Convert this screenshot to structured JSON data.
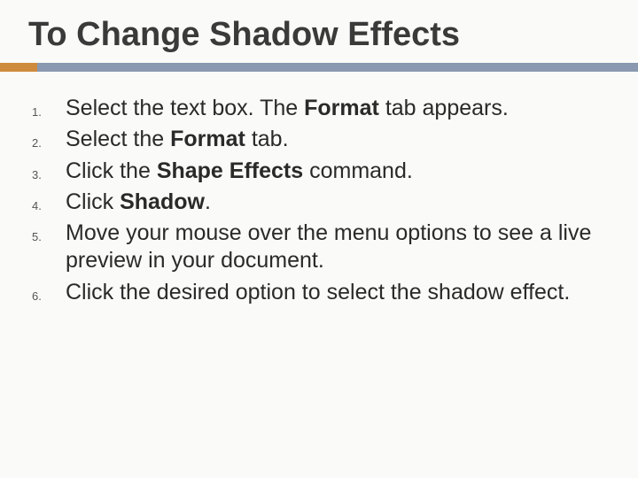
{
  "title": "To Change Shadow Effects",
  "steps": [
    {
      "pre": "Select the text box. The ",
      "bold": "Format",
      "post": " tab appears."
    },
    {
      "pre": "Select the ",
      "bold": "Format",
      "post": " tab."
    },
    {
      "pre": "Click the ",
      "bold": "Shape Effects",
      "post": " command."
    },
    {
      "pre": "Click ",
      "bold": "Shadow",
      "post": "."
    },
    {
      "pre": "Move your mouse over the menu options to see a live preview in your document.",
      "bold": "",
      "post": ""
    },
    {
      "pre": "Click the desired option to select the shadow effect.",
      "bold": "",
      "post": ""
    }
  ],
  "colors": {
    "accent": "#cf8b3d",
    "bar": "#8a98b0"
  }
}
